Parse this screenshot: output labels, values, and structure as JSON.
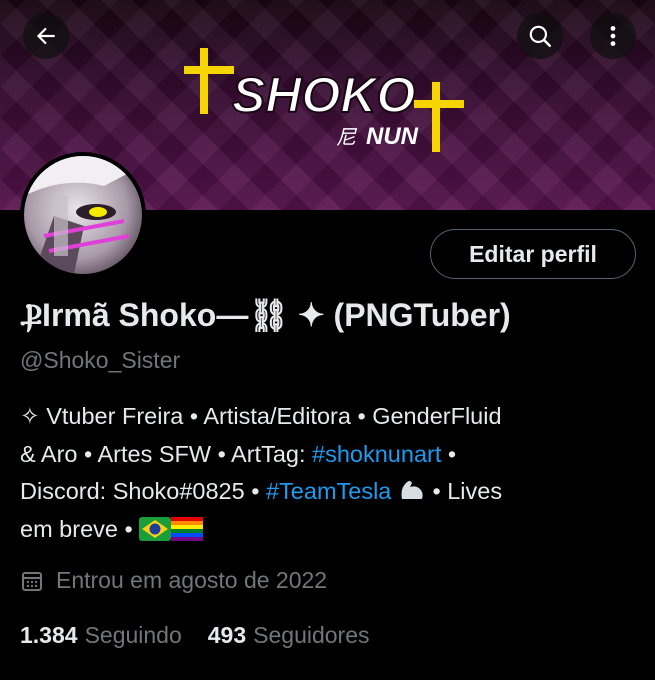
{
  "header": {
    "banner_logo_text": "SHOKO",
    "banner_logo_subtext": "NUN",
    "back_icon": "arrow-left-icon",
    "search_icon": "search-icon",
    "more_icon": "more-vertical-icon"
  },
  "profile": {
    "display_name": "ⳀIrmã Shoko—⛓ ✦ (PNGTuber)",
    "handle": "@Shoko_Sister",
    "edit_button_label": "Editar perfil",
    "bio": {
      "line1": "✧ Vtuber Freira • Artista/Editora • GenderFluid",
      "line2_pre": "& Aro • Artes SFW • ArtTag: ",
      "line2_tag": "#shoknunart",
      "line2_post": " •",
      "line3_pre": "Discord: Shoko#0825 • ",
      "line3_tag": "#TeamTesla",
      "line3_post": " •  Lives",
      "line4": "em breve • "
    },
    "joined": "Entrou em agosto de 2022",
    "following_count": "1.384",
    "following_label": "Seguindo",
    "followers_count": "493",
    "followers_label": "Seguidores"
  },
  "colors": {
    "background": "#000000",
    "text": "#e7e9ea",
    "muted": "#71767b",
    "link": "#1d9bf0",
    "banner_purple": "#5a1450",
    "logo_yellow": "#f5d400"
  }
}
